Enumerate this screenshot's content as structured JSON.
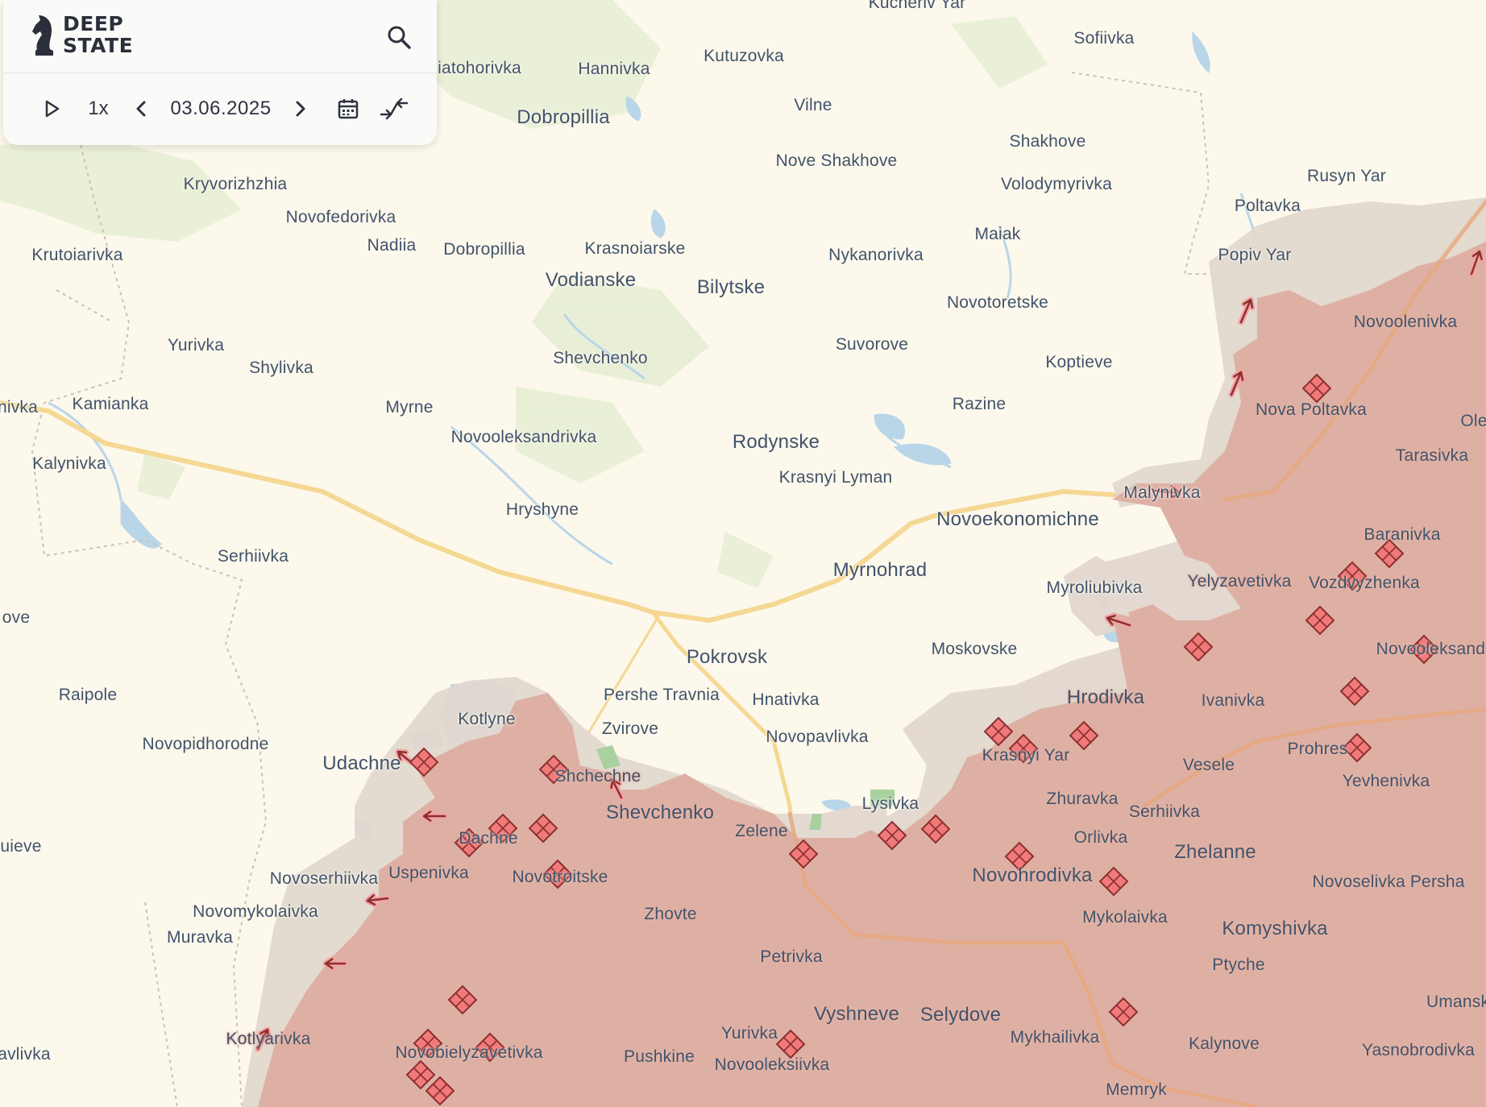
{
  "app": {
    "logo_text_line1": "DEEP",
    "logo_text_line2": "STATE",
    "search_icon": "search-icon"
  },
  "timeline": {
    "play_icon": "play-icon",
    "speed": "1x",
    "prev_icon": "chevron-left-icon",
    "date": "03.06.2025",
    "next_icon": "chevron-right-icon",
    "calendar_icon": "calendar-icon",
    "collapse_icon": "collapse-arrows-icon"
  },
  "colors": {
    "land": "#fdf8ec",
    "occupied": "#deb0a4",
    "contested": "#e3d9d0",
    "road": "#f4d893",
    "water": "#b8d5e6",
    "forest": "#e2ecd0",
    "attack_marker": "#f07a7a",
    "attack_marker_stroke": "#8c2f2f"
  },
  "labels": {
    "kucheriv_yar": "Kucheriv Yar",
    "sofiivka": "Sofiivka",
    "shakhove_nav": "iatohorivka",
    "hannivka": "Hannivka",
    "kutuzovka": "Kutuzovka",
    "dobropillia_big": "Dobropillia",
    "vilne": "Vilne",
    "shakhove": "Shakhove",
    "rusyn_yar": "Rusyn Yar",
    "nove_shakhove": "Nove Shakhove",
    "volodymyrivka": "Volodymyrivka",
    "poltavka": "Poltavka",
    "kryvorizhzhia": "Kryvorizhzhia",
    "novofedorivka": "Novofedorivka",
    "maiak": "Maiak",
    "krutoiarivka": "Krutoiarivka",
    "nadiia": "Nadiia",
    "dobropillia": "Dobropillia",
    "krasnoiarske": "Krasnoiarske",
    "nykanorivka": "Nykanorivka",
    "popiv_yar": "Popiv Yar",
    "vodianske": "Vodianske",
    "bilytske": "Bilytske",
    "novotoretske": "Novotoretske",
    "novoolenivka": "Novoolenivka",
    "yurivka_w": "Yurivka",
    "shevchenko_n": "Shevchenko",
    "suvorove": "Suvorove",
    "shylivka": "Shylivka",
    "koptieve": "Koptieve",
    "nivka": "nivka",
    "kamianka": "Kamianka",
    "myrne": "Myrne",
    "razine": "Razine",
    "nova_poltavka": "Nova Poltavka",
    "ole": "Ole",
    "novooleksandrivka": "Novooleksandrivka",
    "rodynske": "Rodynske",
    "kalynivka": "Kalynivka",
    "tarasivka": "Tarasivka",
    "krasnyi_lyman": "Krasnyi Lyman",
    "malynivka": "Malynivka",
    "hryshyne": "Hryshyne",
    "novoekonomichne": "Novoekonomichne",
    "baranivka": "Baranivka",
    "serhiivka_w": "Serhiivka",
    "myrnohrad": "Myrnohrad",
    "yelyzavetivka": "Yelyzavetivka",
    "vozdvyzhenka": "Vozdvyzhenka",
    "myroliubivka": "Myroliubivka",
    "ove": "ove",
    "novooleksandrivka_e": "Novooleksandr",
    "pokrovsk": "Pokrovsk",
    "moskovske": "Moskovske",
    "raipole": "Raipole",
    "pershe_travnia": "Pershe Travnia",
    "hnativka": "Hnativka",
    "hrodivka": "Hrodivka",
    "ivanivka": "Ivanivka",
    "kotlyne": "Kotlyne",
    "zvirove": "Zvirove",
    "novopidhorodne": "Novopidhorodne",
    "novopavlivka": "Novopavlivka",
    "krasnyi_yar": "Krasnyi Yar",
    "prohres": "Prohres",
    "udachne": "Udachne",
    "vesele": "Vesele",
    "shcherbynivka": "Shchechne",
    "yevhenivka": "Yevhenivka",
    "shevchenko_s": "Shevchenko",
    "zhuravka": "Zhuravka",
    "serhiivka_e": "Serhiivka",
    "lysivka": "Lysivka",
    "zelene": "Zelene",
    "orlivka": "Orlivka",
    "uieve": "uieve",
    "zhelanne": "Zhelanne",
    "dachenske": "Dachne",
    "uspenivka": "Uspenivka",
    "novoserhiivka": "Novoserhiivka",
    "novotroitske": "Novotroitske",
    "novohrodivka": "Novohrodivka",
    "novoselivka_persha": "Novoselivka Persha",
    "novomykolaivka": "Novomykolaivka",
    "zhovte": "Zhovte",
    "mykolaivka": "Mykolaivka",
    "komyshivka": "Komyshivka",
    "muravka": "Muravka",
    "petrivka": "Petrivka",
    "ptyche": "Ptyche",
    "umanske": "Umanske",
    "vyshneve": "Vyshneve",
    "selydove": "Selydove",
    "kotlyarivka": "Kotlyarivka",
    "yurivka_s": "Yurivka",
    "mykhailivka": "Mykhailivka",
    "kalynove": "Kalynove",
    "avlivka": "avlivka",
    "novobielyzavetivka": "Novobielyzavetivka",
    "pushkine": "Pushkine",
    "novooleksiivka": "Novooleksiivka",
    "yasnobrodivka": "Yasnobrodivka",
    "memryk": "Memryk"
  }
}
